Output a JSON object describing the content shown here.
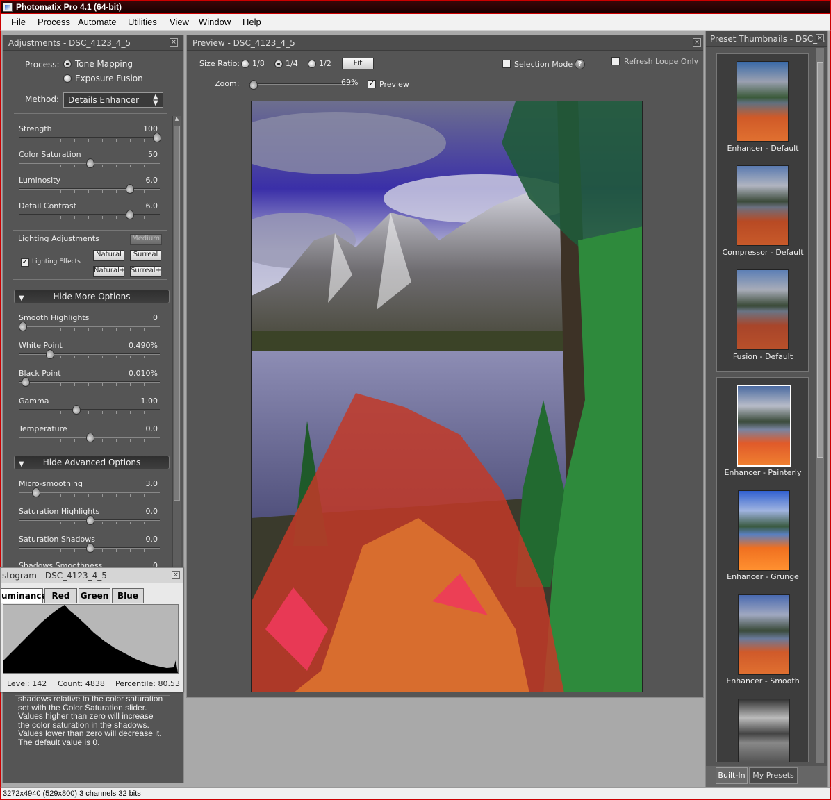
{
  "window": {
    "title": "Photomatix Pro 4.1 (64-bit)"
  },
  "menu": [
    "File",
    "Process",
    "Automate",
    "Utilities",
    "View",
    "Window",
    "Help"
  ],
  "adjustments": {
    "title": "Adjustments - DSC_4123_4_5",
    "process_label": "Process:",
    "process_options": [
      "Tone Mapping",
      "Exposure Fusion"
    ],
    "method_label": "Method:",
    "method_value": "Details Enhancer",
    "sliders_main": [
      {
        "label": "Strength",
        "value": "100",
        "fraction": 1.0
      },
      {
        "label": "Color Saturation",
        "value": "50",
        "fraction": 0.5
      },
      {
        "label": "Luminosity",
        "value": "6.0",
        "fraction": 0.8
      },
      {
        "label": "Detail Contrast",
        "value": "6.0",
        "fraction": 0.8
      }
    ],
    "lighting": {
      "title": "Lighting Adjustments",
      "medium": "Medium",
      "effects_label": "Lighting Effects",
      "natural": "Natural",
      "surreal": "Surreal",
      "natural_plus": "Natural+",
      "surreal_plus": "Surreal+"
    },
    "more_options": "Hide More Options",
    "sliders_more": [
      {
        "label": "Smooth Highlights",
        "value": "0",
        "fraction": 0.0
      },
      {
        "label": "White Point",
        "value": "0.490%",
        "fraction": 0.2
      },
      {
        "label": "Black Point",
        "value": "0.010%",
        "fraction": 0.02
      },
      {
        "label": "Gamma",
        "value": "1.00",
        "fraction": 0.4
      },
      {
        "label": "Temperature",
        "value": "0.0",
        "fraction": 0.5
      }
    ],
    "advanced_options": "Hide Advanced Options",
    "sliders_adv": [
      {
        "label": "Micro-smoothing",
        "value": "3.0",
        "fraction": 0.1
      },
      {
        "label": "Saturation Highlights",
        "value": "0.0",
        "fraction": 0.5
      },
      {
        "label": "Saturation Shadows",
        "value": "0.0",
        "fraction": 0.5
      },
      {
        "label": "Shadows Smoothness",
        "value": "0",
        "fraction": 0.0
      }
    ],
    "help_text": "shadows relative to the color saturation set with the Color Saturation slider. Values higher than zero will increase the color saturation in the shadows. Values lower than zero will decrease it. The default value is 0."
  },
  "histogram": {
    "title": "stogram - DSC_4123_4_5",
    "tabs": [
      "uminance",
      "Red",
      "Green",
      "Blue"
    ],
    "level": "Level: 142",
    "count": "Count: 4838",
    "percentile": "Percentile: 80.53"
  },
  "preview": {
    "title": "Preview - DSC_4123_4_5",
    "size_ratio_label": "Size Ratio:",
    "size_ratios": [
      "1/8",
      "1/4",
      "1/2"
    ],
    "fit": "Fit",
    "selection_mode": "Selection Mode",
    "refresh_loupe": "Refresh Loupe Only",
    "zoom_label": "Zoom:",
    "zoom_value": "69%",
    "zoom_fraction": 0.0,
    "preview_label": "Preview"
  },
  "presets": {
    "title": "Preset Thumbnails - DSC_...",
    "builtin": [
      "Enhancer - Default",
      "Compressor - Default",
      "Fusion - Default"
    ],
    "mine": [
      "Enhancer - Painterly",
      "Enhancer - Grunge",
      "Enhancer - Smooth"
    ],
    "tabs": [
      "Built-In",
      "My Presets"
    ]
  },
  "status": {
    "text": "3272x4940 (529x800) 3 channels 32 bits"
  }
}
